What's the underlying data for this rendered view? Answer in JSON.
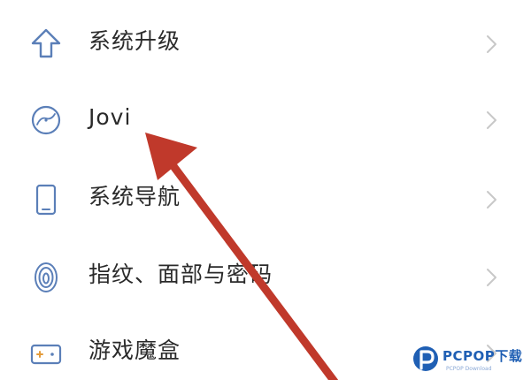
{
  "settings": {
    "items": [
      {
        "label": "系统升级",
        "icon": "upgrade-arrow-icon"
      },
      {
        "label": "Jovi",
        "icon": "jovi-logo-icon"
      },
      {
        "label": "系统导航",
        "icon": "phone-navigation-icon"
      },
      {
        "label": "指纹、面部与密码",
        "icon": "fingerprint-icon"
      },
      {
        "label": "游戏魔盒",
        "icon": "game-box-icon"
      }
    ]
  },
  "annotation": {
    "arrow_color": "#c0392b"
  },
  "watermark": {
    "brand": "PCPOP下载",
    "tagline": "PCPOP Download"
  }
}
